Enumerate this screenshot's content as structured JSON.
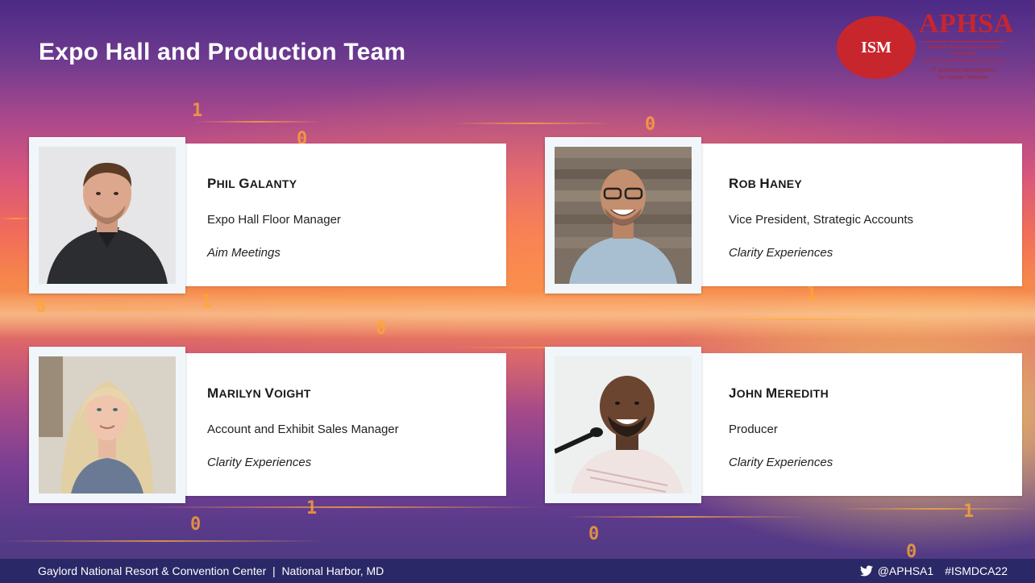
{
  "slide": {
    "title": "Expo Hall and Production Team"
  },
  "logos": {
    "ism": "ISM",
    "aphsa": "APHSA",
    "aphsa_tagline": "American Public Human Services Association",
    "aphsa_subtitle_1": "IT Solutions Management",
    "aphsa_subtitle_2": "for Human Services"
  },
  "people": [
    {
      "first_initial": "P",
      "first_rest": "HIL",
      "last_initial": "G",
      "last_rest": "ALANTY",
      "role": "Expo Hall Floor Manager",
      "org": "Aim Meetings"
    },
    {
      "first_initial": "R",
      "first_rest": "OB",
      "last_initial": "H",
      "last_rest": "ANEY",
      "role": "Vice President, Strategic Accounts",
      "org": "Clarity Experiences"
    },
    {
      "first_initial": "M",
      "first_rest": "ARILYN",
      "last_initial": "V",
      "last_rest": "OIGHT",
      "role": "Account and Exhibit Sales Manager",
      "org": "Clarity Experiences"
    },
    {
      "first_initial": "J",
      "first_rest": "OHN",
      "last_initial": "M",
      "last_rest": "EREDITH",
      "role": "Producer",
      "org": "Clarity Experiences"
    }
  ],
  "footer": {
    "venue": "Gaylord National Resort & Convention Center  |  National Harbor, MD",
    "handle": "@APHSA1",
    "hashtag": "#ISMDCA22"
  },
  "colors": {
    "footer_bg": "#2a2866",
    "brand_red": "#c8262d"
  }
}
